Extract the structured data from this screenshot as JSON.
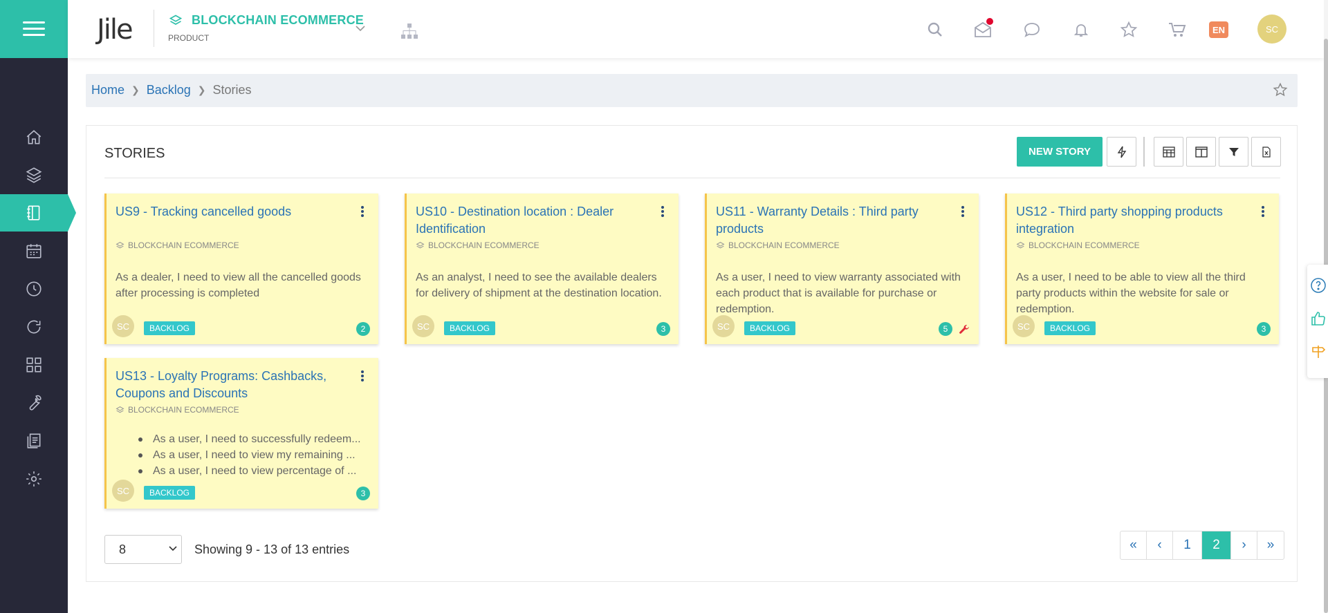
{
  "sidebar": {
    "items": [
      {
        "name": "home-icon"
      },
      {
        "name": "layers-icon"
      },
      {
        "name": "notebook-icon",
        "active": true
      },
      {
        "name": "calendar-icon"
      },
      {
        "name": "clock-icon"
      },
      {
        "name": "refresh-icon"
      },
      {
        "name": "apps-grid-icon"
      },
      {
        "name": "wrench-icon"
      },
      {
        "name": "documents-icon"
      },
      {
        "name": "settings-icon"
      }
    ]
  },
  "header": {
    "logo_text": "Jile",
    "project_name": "BLOCKCHAIN ECOMMERCE",
    "project_type": "PRODUCT",
    "language": "EN",
    "user_initials": "SC",
    "icons": [
      "search-icon",
      "mail-icon",
      "chat-icon",
      "bell-icon",
      "star-icon",
      "cart-icon"
    ]
  },
  "breadcrumb": {
    "items": [
      "Home",
      "Backlog"
    ],
    "current": "Stories"
  },
  "panel": {
    "title": "STORIES",
    "new_button": "NEW STORY"
  },
  "cards": [
    {
      "title": "US9 - Tracking cancelled goods",
      "project": "BLOCKCHAIN ECOMMERCE",
      "description": "As a dealer, I need to view all the cancelled goods after processing is completed",
      "assignee": "SC",
      "status": "BACKLOG",
      "count": "2"
    },
    {
      "title": "US10 - Destination location : Dealer Identification",
      "project": "BLOCKCHAIN ECOMMERCE",
      "description": "As an analyst, I need to see the available dealers for delivery of shipment at the destination location.",
      "assignee": "SC",
      "status": "BACKLOG",
      "count": "3"
    },
    {
      "title": "US11 - Warranty Details : Third party products",
      "project": "BLOCKCHAIN ECOMMERCE",
      "description": "As a user, I need to view warranty associated with each product that is available for purchase or redemption.",
      "assignee": "SC",
      "status": "BACKLOG",
      "count": "5"
    },
    {
      "title": "US12 - Third party shopping products integration",
      "project": "BLOCKCHAIN ECOMMERCE",
      "description": "As a user, I need to be able to view all the third party products within the website for sale or redemption.",
      "assignee": "SC",
      "status": "BACKLOG",
      "count": "3"
    },
    {
      "title": "US13 - Loyalty Programs: Cashbacks, Coupons and Discounts",
      "project": "BLOCKCHAIN ECOMMERCE",
      "bullets": [
        "As a user, I need to successfully redeem...",
        "As a user, I need to view my remaining ...",
        "As a user, I need to view percentage of ..."
      ],
      "assignee": "SC",
      "status": "BACKLOG",
      "count": "3"
    }
  ],
  "pagination": {
    "page_size": "8",
    "showing": "Showing 9 - 13 of 13 entries",
    "first": "«",
    "prev": "‹",
    "pages": [
      "1",
      "2"
    ],
    "current_page": "2",
    "next": "›",
    "last": "»"
  },
  "colors": {
    "accent": "#2dbfa9",
    "sidebar": "#272838",
    "card_bg": "#fefbc3",
    "card_border": "#f5c44a",
    "link": "#2a73b5",
    "status_badge": "#33c7cb",
    "lang_badge": "#f08a5d",
    "notification_dot": "#e0062e"
  }
}
